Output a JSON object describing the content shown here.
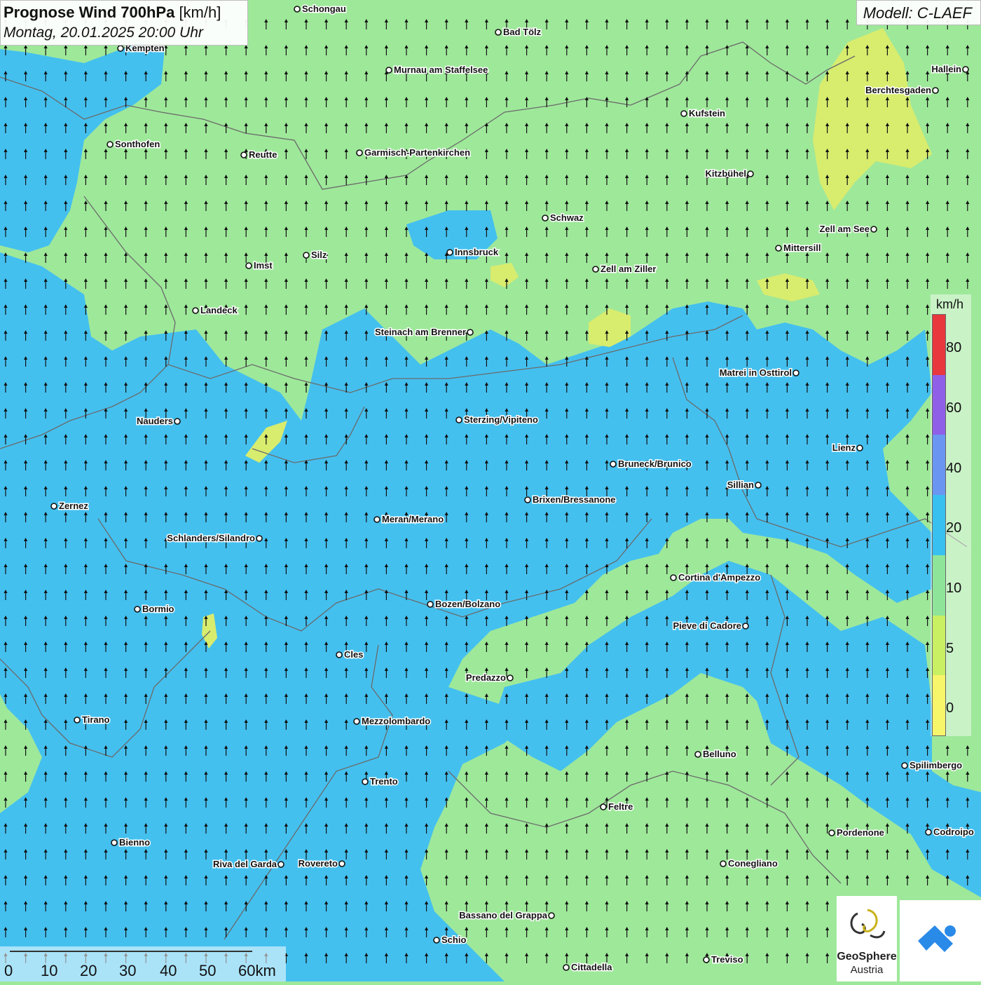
{
  "header": {
    "title_bold": "Prognose Wind 700hPa",
    "title_unit": "[km/h]",
    "datetime": "Montag, 20.01.2025 20:00 Uhr"
  },
  "model": {
    "label": "Modell: C-LAEF"
  },
  "legend": {
    "unit": "km/h",
    "ticks": [
      "80",
      "60",
      "40",
      "20",
      "10",
      "5",
      "0"
    ],
    "colors": [
      "#e8383d",
      "#8f5fe8",
      "#6a96f2",
      "#38c0f0",
      "#8ee59a",
      "#c9ef62",
      "#f7f56a"
    ]
  },
  "scale": {
    "labels": [
      "0",
      "10",
      "20",
      "30",
      "40",
      "50",
      "60km"
    ]
  },
  "branding": {
    "name": "GeoSphere",
    "sub": "Austria"
  },
  "colors": {
    "calm": "#9ee89a",
    "moderate": "#44c0ef",
    "light": "#d8ec6e",
    "arrow": "#111111"
  },
  "wind": {
    "direction": "north"
  },
  "cities": [
    {
      "name": "Schongau"
    },
    {
      "name": "Bad Tölz"
    },
    {
      "name": "Kempten"
    },
    {
      "name": "Murnau am Staffelsee"
    },
    {
      "name": "Hallein"
    },
    {
      "name": "Berchtesgaden"
    },
    {
      "name": "Kufstein"
    },
    {
      "name": "Sonthofen"
    },
    {
      "name": "Reutte"
    },
    {
      "name": "Garmisch-Partenkirchen"
    },
    {
      "name": "Kitzbühel"
    },
    {
      "name": "Schwaz"
    },
    {
      "name": "Zell am See"
    },
    {
      "name": "Mittersill"
    },
    {
      "name": "Innsbruck"
    },
    {
      "name": "Imst"
    },
    {
      "name": "Silz"
    },
    {
      "name": "Zell am Ziller"
    },
    {
      "name": "Landeck"
    },
    {
      "name": "Steinach am Brenner"
    },
    {
      "name": "Matrei in Osttirol"
    },
    {
      "name": "Nauders"
    },
    {
      "name": "Sterzing/Vipiteno"
    },
    {
      "name": "Lienz"
    },
    {
      "name": "Bruneck/Brunico"
    },
    {
      "name": "Sillian"
    },
    {
      "name": "Zernez"
    },
    {
      "name": "Brixen/Bressanone"
    },
    {
      "name": "Meran/Merano"
    },
    {
      "name": "Schlanders/Silandro"
    },
    {
      "name": "Cortina d'Ampezzo"
    },
    {
      "name": "Bozen/Bolzano"
    },
    {
      "name": "Bormio"
    },
    {
      "name": "Pieve di Cadore"
    },
    {
      "name": "Cles"
    },
    {
      "name": "Predazzo"
    },
    {
      "name": "Tirano"
    },
    {
      "name": "Mezzolombardo"
    },
    {
      "name": "Belluno"
    },
    {
      "name": "Spilimbergo"
    },
    {
      "name": "Trento"
    },
    {
      "name": "Feltre"
    },
    {
      "name": "Pordenone"
    },
    {
      "name": "Codroipo"
    },
    {
      "name": "Bienno"
    },
    {
      "name": "Riva del Garda"
    },
    {
      "name": "Rovereto"
    },
    {
      "name": "Conegliano"
    },
    {
      "name": "Bassano del Grappa"
    },
    {
      "name": "Schio"
    },
    {
      "name": "Treviso"
    },
    {
      "name": "Cittadella"
    }
  ]
}
